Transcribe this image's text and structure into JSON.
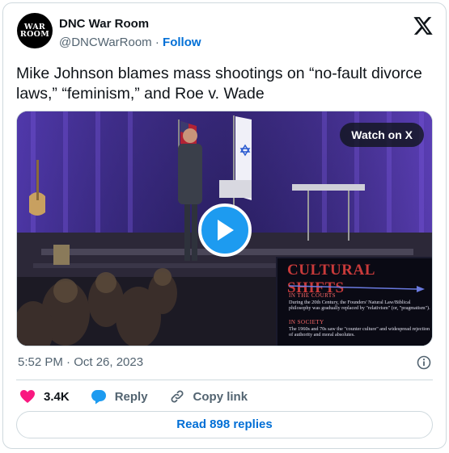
{
  "account": {
    "avatar_text": "WAR\nROOM",
    "display_name": "DNC War Room",
    "handle": "@DNCWarRoom",
    "separator": "·",
    "follow_label": "Follow",
    "platform_icon": "x-logo-icon"
  },
  "tweet": {
    "text": "Mike Johnson blames mass shootings on “no-fault divorce laws,” “feminism,” and Roe v. Wade",
    "timestamp": "5:52 PM · Oct 26, 2023"
  },
  "media": {
    "watch_label": "Watch on X",
    "play_icon": "play-icon",
    "slide": {
      "title": "CULTURAL SHIFTS",
      "section1_head": "IN THE COURTS",
      "section1_body": "During the 20th Century, the Founders' Natural Law/Biblical philosophy was gradually replaced by \"relativism\" (or, \"pragmatism\").",
      "section2_head": "IN SOCIETY",
      "section2_body": "The 1960s and 70s saw the \"counter culture\" and widespread rejection of authority and moral absolutes."
    }
  },
  "actions": {
    "like_count": "3.4K",
    "reply_label": "Reply",
    "copy_link_label": "Copy link",
    "read_replies_label": "Read 898 replies"
  },
  "colors": {
    "link_blue": "#006fd6",
    "like_red": "#f91880",
    "reply_blue": "#1d9bf0",
    "muted": "#536471"
  }
}
